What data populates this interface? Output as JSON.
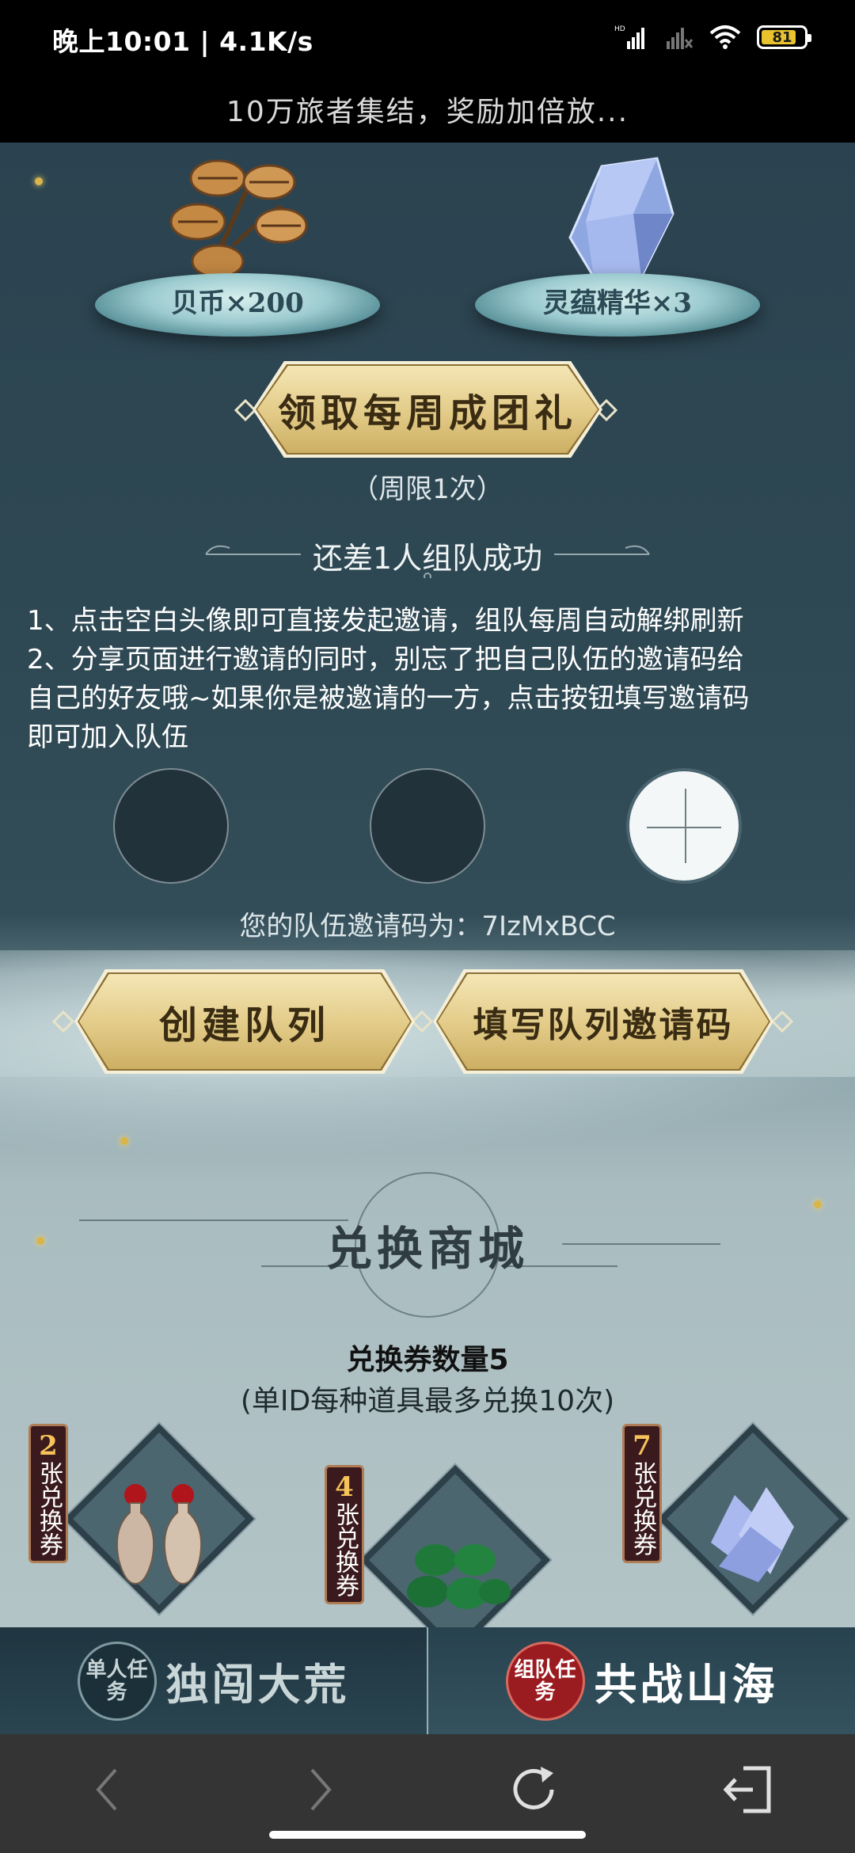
{
  "status_bar": {
    "time_speed": "晚上10:01 | 4.1K/s",
    "battery": "81"
  },
  "page": {
    "title": "10万旅者集结，奖励加倍放..."
  },
  "rewards": [
    {
      "label": "贝币×200"
    },
    {
      "label": "灵蕴精华×3"
    }
  ],
  "weekly": {
    "claim_button": "领取每周成团礼",
    "limit": "（周限1次）",
    "team_status": "还差1人组队成功"
  },
  "rules": {
    "line1": "1、点击空白头像即可直接发起邀请，组队每周自动解绑刷新",
    "line2a": "2、分享页面进行邀请的同时，别忘了把自己队伍的邀请码给",
    "line2b": "自己的好友哦~如果你是被邀请的一方，点击按钮填写邀请码",
    "line2c": "即可加入队伍"
  },
  "team": {
    "invite_code_text": "您的队伍邀请码为：7IzMxBCC",
    "create_button": "创建队列",
    "fill_button": "填写队列邀请码"
  },
  "shop": {
    "title": "兑换商城",
    "voucher_count": "兑换券数量5",
    "limit_note": "(单ID每种道具最多兑换10次)",
    "items": [
      {
        "num": "2",
        "unit": "张兑换券"
      },
      {
        "num": "4",
        "unit": "张兑换券"
      },
      {
        "num": "7",
        "unit": "张兑换券"
      }
    ]
  },
  "tabs": {
    "single_seal": "单人任务",
    "single_label": "独闯大荒",
    "team_seal": "组队任务",
    "team_label": "共战山海"
  }
}
